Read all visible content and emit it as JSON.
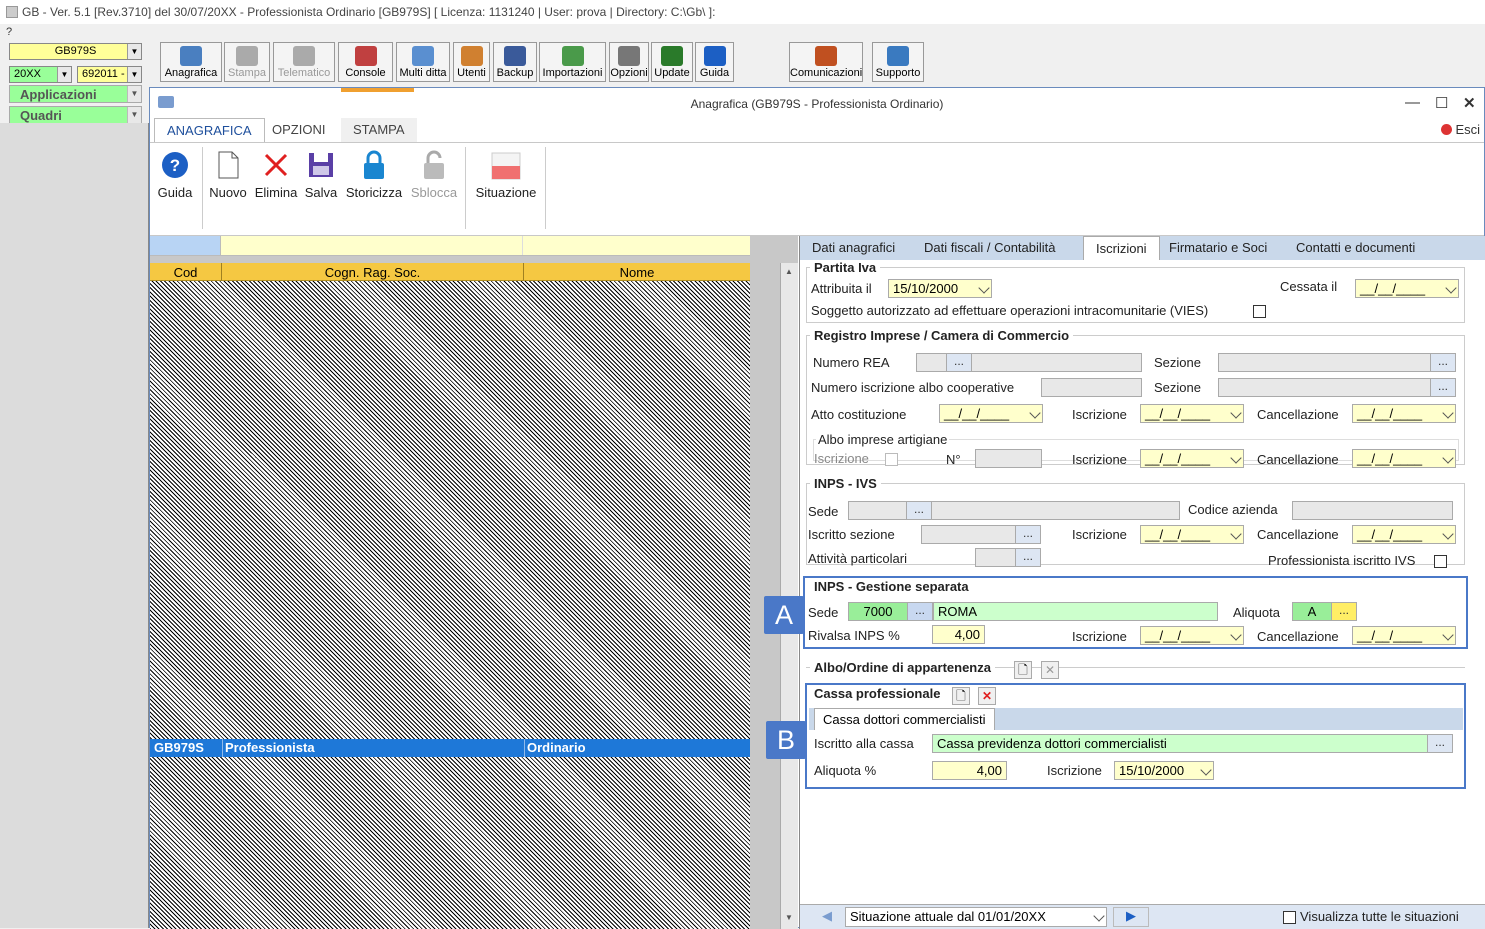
{
  "app": {
    "title": "GB - Ver. 5.1 [Rev.3710] del 30/07/20XX -  Professionista Ordinario [GB979S]   [ Licenza: 1131240 | User: prova | Directory: C:\\Gb\\ ]:",
    "help_menu": "?"
  },
  "left": {
    "company": "GB979S",
    "year": "20XX",
    "code": "692011 -",
    "applicazioni": "Applicazioni",
    "quadri": "Quadri"
  },
  "toolbar": [
    {
      "label": "Anagrafica",
      "icon": "address-book-icon",
      "enabled": true
    },
    {
      "label": "Stampa",
      "icon": "printer-icon",
      "enabled": false
    },
    {
      "label": "Telematico",
      "icon": "telematico-icon",
      "enabled": false
    },
    {
      "label": "Console",
      "icon": "console-icon",
      "enabled": true
    },
    {
      "label": "Multi ditta",
      "icon": "multi-company-icon",
      "enabled": true
    },
    {
      "label": "Utenti",
      "icon": "users-icon",
      "enabled": true
    },
    {
      "label": "Backup",
      "icon": "backup-icon",
      "enabled": true
    },
    {
      "label": "Importazioni",
      "icon": "import-icon",
      "enabled": true
    },
    {
      "label": "Opzioni",
      "icon": "wrench-icon",
      "enabled": true
    },
    {
      "label": "Update",
      "icon": "update-icon",
      "enabled": true
    },
    {
      "label": "Guida",
      "icon": "help-icon",
      "enabled": true
    },
    {
      "label": "Comunicazioni",
      "icon": "communications-icon",
      "enabled": true
    },
    {
      "label": "Supporto",
      "icon": "support-icon",
      "enabled": true
    }
  ],
  "window": {
    "title": "Anagrafica (GB979S - Professionista Ordinario)",
    "close_label": "Esci",
    "ribbon_tabs": [
      "ANAGRAFICA",
      "OPZIONI",
      "STAMPA"
    ],
    "ribbon_buttons": [
      {
        "label": "Guida",
        "icon": "help-icon",
        "enabled": true
      },
      {
        "label": "Nuovo",
        "icon": "new-document-icon",
        "enabled": true
      },
      {
        "label": "Elimina",
        "icon": "delete-icon",
        "enabled": true
      },
      {
        "label": "Salva",
        "icon": "save-icon",
        "enabled": true
      },
      {
        "label": "Storicizza",
        "icon": "lock-icon",
        "enabled": true
      },
      {
        "label": "Sblocca",
        "icon": "unlock-icon",
        "enabled": false
      },
      {
        "label": "Situazione",
        "icon": "situation-icon",
        "enabled": true
      }
    ]
  },
  "list": {
    "columns": [
      "Cod",
      "Cogn. Rag. Soc.",
      "Nome"
    ],
    "selected_row": {
      "cod": "GB979S",
      "cognome": "Professionista",
      "nome": "Ordinario"
    }
  },
  "detail": {
    "tabs": [
      "Dati anagrafici",
      "Dati fiscali / Contabilità",
      "Iscrizioni",
      "Firmatario e Soci",
      "Contatti e documenti"
    ],
    "partita_iva": {
      "title": "Partita Iva",
      "attribuita_label": "Attribuita il",
      "attribuita_value": "15/10/2000",
      "cessata_label": "Cessata il",
      "cessata_value": "__/__/____",
      "vies_label": "Soggetto autorizzato ad effettuare operazioni intracomunitarie (VIES)"
    },
    "registro": {
      "title": "Registro Imprese / Camera di Commercio",
      "rea_label": "Numero REA",
      "sezione_label": "Sezione",
      "albo_coop_label": "Numero iscrizione albo cooperative",
      "atto_label": "Atto costituzione",
      "iscrizione_label": "Iscrizione",
      "cancellazione_label": "Cancellazione",
      "empty_date": "__/__/____",
      "artigiane_title": "Albo imprese artigiane",
      "artigiane_iscrizione": "Iscrizione",
      "artigiane_n": "N°"
    },
    "inps_ivs": {
      "title": "INPS - IVS",
      "sede_label": "Sede",
      "codice_azienda_label": "Codice azienda",
      "iscritto_sezione_label": "Iscritto sezione",
      "attivita_label": "Attività particolari",
      "prof_ivs_label": "Professionista iscritto IVS"
    },
    "gestione_separata": {
      "badge": "A",
      "title": "INPS - Gestione separata",
      "sede_label": "Sede",
      "sede_code": "7000",
      "sede_name": "ROMA",
      "aliquota_label": "Aliquota",
      "aliquota_value": "A",
      "rivalsa_label": "Rivalsa INPS %",
      "rivalsa_value": "4,00"
    },
    "albo": {
      "title": "Albo/Ordine di appartenenza"
    },
    "cassa": {
      "badge": "B",
      "title": "Cassa professionale",
      "tab": "Cassa  dottori commercialisti",
      "iscritto_label": "Iscritto alla cassa",
      "iscritto_value": "Cassa previdenza dottori commercialisti",
      "aliquota_label": "Aliquota %",
      "aliquota_value": "4,00",
      "iscrizione_label": "Iscrizione",
      "iscrizione_value": "15/10/2000"
    },
    "status": {
      "situazione": "Situazione attuale dal 01/01/20XX",
      "visualizza": "Visualizza tutte le situazioni"
    }
  },
  "colors": {
    "accent": "#4a78c8",
    "selection": "#1e78d8",
    "header": "#f5c842",
    "required": "#ffffcc",
    "valid": "#ccffcc"
  }
}
